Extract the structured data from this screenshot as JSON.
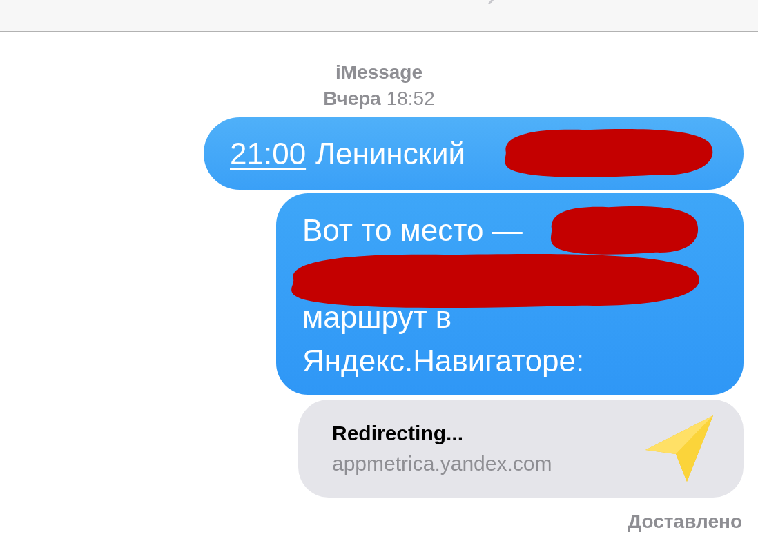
{
  "service": "iMessage",
  "timestamp": "**Вчера** 18:52",
  "messages": [
    {
      "kind": "text",
      "link": "21:00",
      "lines": [
        "Ленинский"
      ],
      "redacted": true
    },
    {
      "kind": "text",
      "lines": [
        "Вот то место —",
        "маршрут в",
        "Яндекс.Навигаторе:"
      ],
      "redacted": true
    },
    {
      "kind": "link",
      "title": "Redirecting...",
      "domain": "appmetrica.yandex.com"
    }
  ],
  "status": "Доставлено"
}
